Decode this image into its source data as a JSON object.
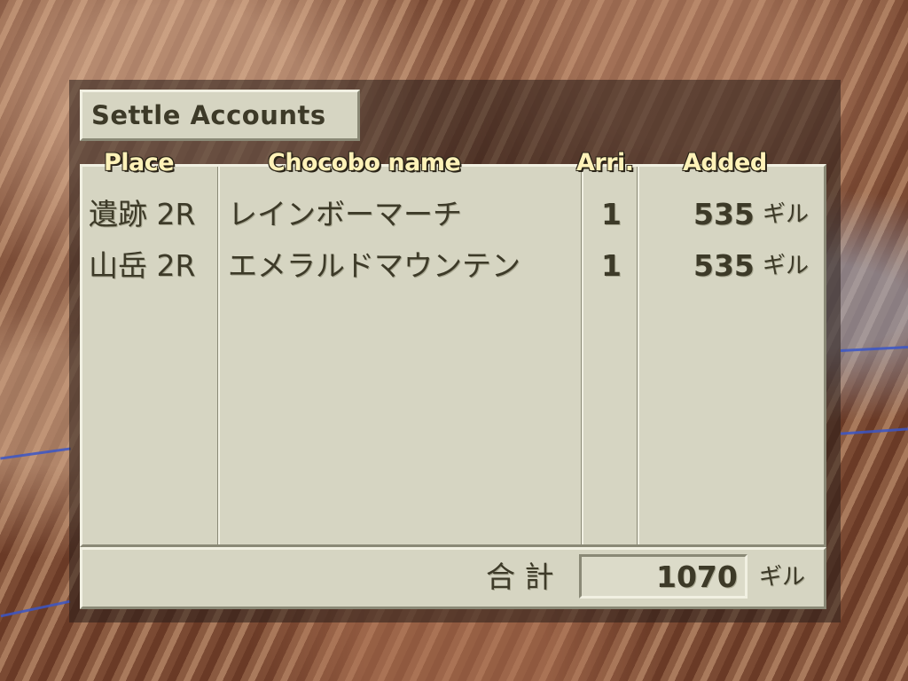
{
  "title": "Settle Accounts",
  "headers": {
    "place": "Place",
    "chocobo_name": "Chocobo name",
    "arrival": "Arri.",
    "added": "Added"
  },
  "rows": [
    {
      "place": "遺跡 2R",
      "name": "レインボーマーチ",
      "arrival": "1",
      "added": "535",
      "unit": "ギル"
    },
    {
      "place": "山岳 2R",
      "name": "エメラルドマウンテン",
      "arrival": "1",
      "added": "535",
      "unit": "ギル"
    }
  ],
  "total": {
    "label": "合 計",
    "value": "1070",
    "unit": "ギル"
  },
  "colors": {
    "panel": "#d6d5c2",
    "text": "#3d3a28",
    "header_text": "#fff2b8"
  }
}
